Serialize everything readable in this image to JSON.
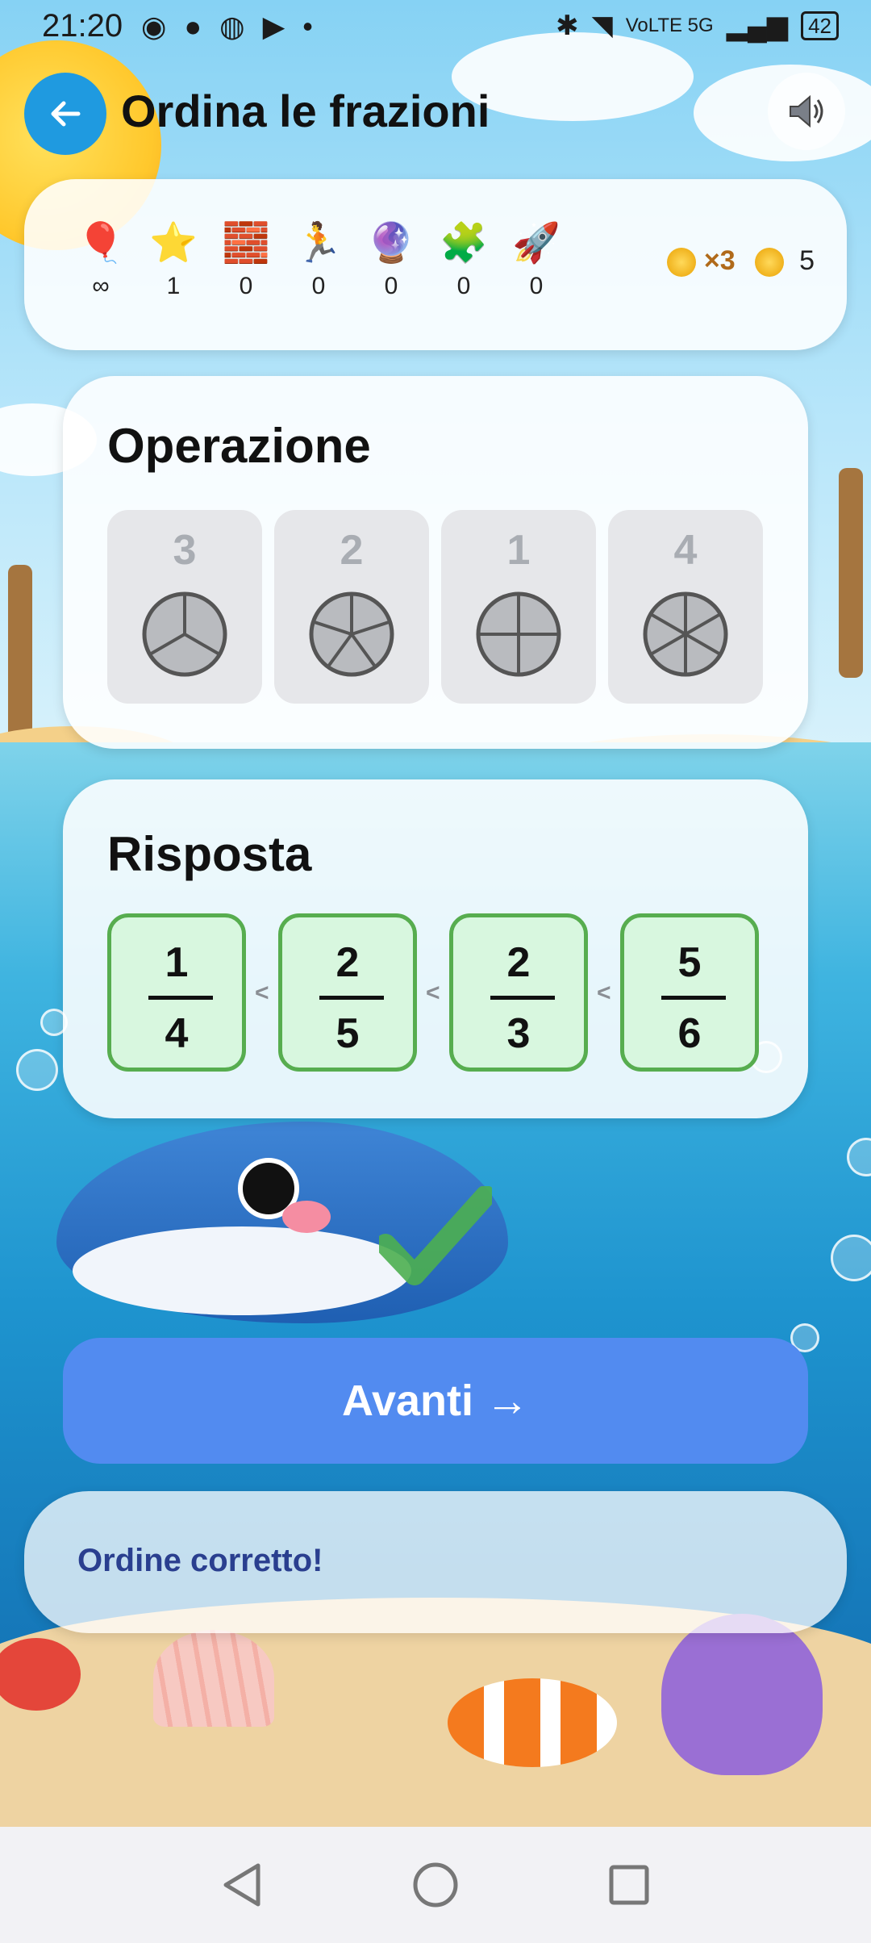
{
  "status_bar": {
    "time": "21:20",
    "left_icons": "◉ ● ◍ ▶ •",
    "network": "VoLTE 5G",
    "battery": "42"
  },
  "header": {
    "title": "Ordina le frazioni"
  },
  "stats": {
    "items": [
      {
        "icon": "🎈",
        "value": "∞"
      },
      {
        "icon": "⭐",
        "value": "1"
      },
      {
        "icon": "🧱",
        "value": "0"
      },
      {
        "icon": "🏃",
        "value": "0"
      },
      {
        "icon": "🔮",
        "value": "0"
      },
      {
        "icon": "🧩",
        "value": "0"
      },
      {
        "icon": "🚀",
        "value": "0"
      }
    ],
    "multiplier": "×3",
    "coins": "5"
  },
  "operation": {
    "title": "Operazione",
    "tiles": [
      {
        "number": "3",
        "slices": 3
      },
      {
        "number": "2",
        "slices": 5
      },
      {
        "number": "1",
        "slices": 4
      },
      {
        "number": "4",
        "slices": 6
      }
    ]
  },
  "answer": {
    "title": "Risposta",
    "fractions": [
      {
        "num": "1",
        "den": "4"
      },
      {
        "num": "2",
        "den": "5"
      },
      {
        "num": "2",
        "den": "3"
      },
      {
        "num": "5",
        "den": "6"
      }
    ],
    "separator": "<"
  },
  "next_button": {
    "label": "Avanti →"
  },
  "feedback": {
    "message": "Ordine corretto!"
  },
  "colors": {
    "accent": "#528bf0",
    "back": "#1f9ae0",
    "correct_fill": "#d8f7df",
    "correct_border": "#57ad4f",
    "check": "#4caf50"
  }
}
